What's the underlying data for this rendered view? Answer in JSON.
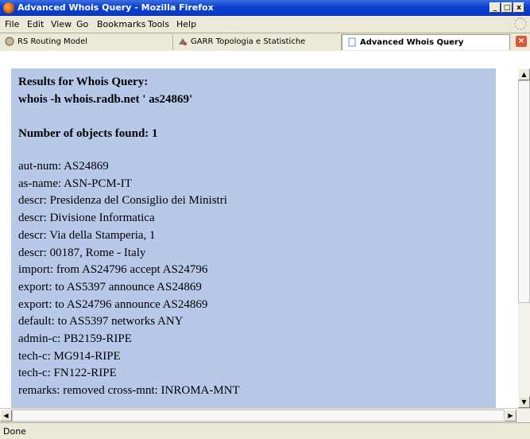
{
  "window": {
    "title": "Advanced Whois Query - Mozilla Firefox"
  },
  "menubar": {
    "items": [
      {
        "label": "File",
        "accel": "F"
      },
      {
        "label": "Edit",
        "accel": "E"
      },
      {
        "label": "View",
        "accel": "V"
      },
      {
        "label": "Go",
        "accel": "G"
      },
      {
        "label": "Bookmarks",
        "accel": "B"
      },
      {
        "label": "Tools",
        "accel": "T"
      },
      {
        "label": "Help",
        "accel": "H"
      }
    ]
  },
  "tabs": [
    {
      "label": "RS Routing Model",
      "active": false
    },
    {
      "label": "GARR Topologia e Statistiche",
      "active": false
    },
    {
      "label": "Advanced Whois Query",
      "active": true
    }
  ],
  "content": {
    "heading_1": "Results for Whois Query:",
    "heading_2": "whois -h whois.radb.net ' as24869'",
    "count_heading": "Number of objects found: 1",
    "lines": [
      "aut-num: AS24869",
      "as-name: ASN-PCM-IT",
      "descr: Presidenza del Consiglio dei Ministri",
      "descr: Divisione Informatica",
      "descr: Via della Stamperia, 1",
      "descr: 00187, Rome - Italy",
      "import: from AS24796 accept AS24796",
      "export: to AS5397 announce AS24869",
      "export: to AS24796 announce AS24869",
      "default: to AS5397 networks ANY",
      "admin-c: PB2159-RIPE",
      "tech-c: MG914-RIPE",
      "tech-c: FN122-RIPE",
      "remarks: removed cross-mnt: INROMA-MNT"
    ]
  },
  "status": {
    "text": "Done"
  },
  "colors": {
    "content_bg": "#b8c8e8",
    "titlebar": "#0a3fd0"
  }
}
